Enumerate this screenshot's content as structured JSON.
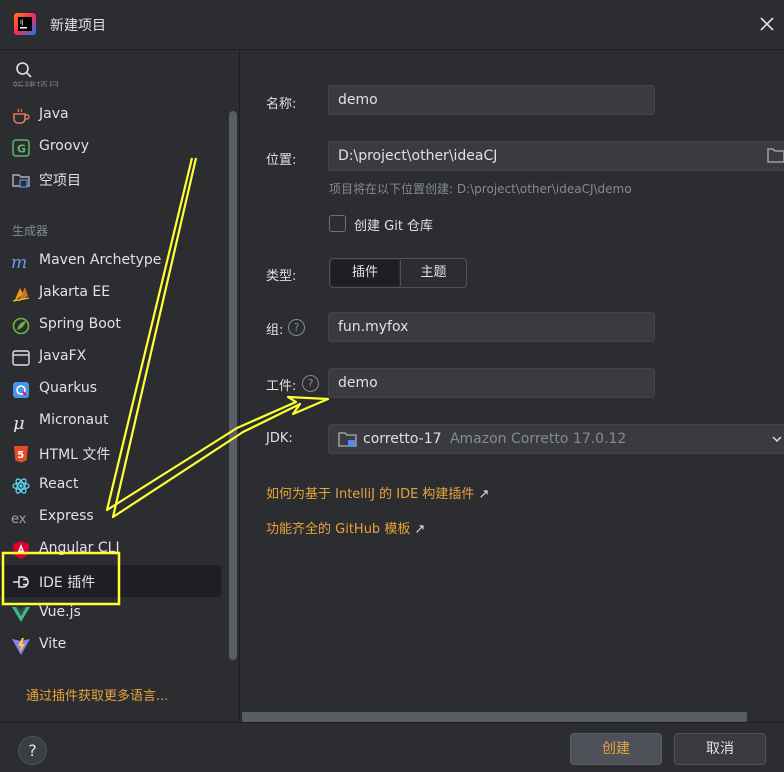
{
  "window": {
    "title": "新建项目"
  },
  "sidebar": {
    "search_icon": "search-icon",
    "cut_header": "新建项目",
    "group_generators": "生成器",
    "items_top": [
      {
        "label": "Java",
        "icon": "java-icon"
      },
      {
        "label": "Groovy",
        "icon": "groovy-icon"
      },
      {
        "label": "空项目",
        "icon": "empty-project-icon"
      }
    ],
    "items_gen": [
      {
        "label": "Maven Archetype",
        "icon": "maven-icon"
      },
      {
        "label": "Jakarta EE",
        "icon": "jakarta-icon"
      },
      {
        "label": "Spring Boot",
        "icon": "spring-icon"
      },
      {
        "label": "JavaFX",
        "icon": "javafx-icon"
      },
      {
        "label": "Quarkus",
        "icon": "quarkus-icon"
      },
      {
        "label": "Micronaut",
        "icon": "micronaut-icon"
      },
      {
        "label": "HTML 文件",
        "icon": "html5-icon"
      },
      {
        "label": "React",
        "icon": "react-icon"
      },
      {
        "label": "Express",
        "icon": "express-icon"
      },
      {
        "label": "Angular CLI",
        "icon": "angular-icon"
      },
      {
        "label": "IDE 插件",
        "icon": "plugin-icon"
      },
      {
        "label": "Vue.js",
        "icon": "vue-icon"
      },
      {
        "label": "Vite",
        "icon": "vite-icon"
      }
    ],
    "more_languages": "通过插件获取更多语言..."
  },
  "form": {
    "name_label": "名称:",
    "name_value": "demo",
    "location_label": "位置:",
    "location_value": "D:\\project\\other\\ideaCJ",
    "location_hint": "项目将在以下位置创建: D:\\project\\other\\ideaCJ\\demo",
    "git_label": "创建 Git 仓库",
    "type_label": "类型:",
    "type_options": [
      "插件",
      "主题"
    ],
    "group_label": "组:",
    "group_value": "fun.myfox",
    "artifact_label": "工件:",
    "artifact_value": "demo",
    "jdk_label": "JDK:",
    "jdk_name": "corretto-17",
    "jdk_version": "Amazon Corretto 17.0.12",
    "link1": "如何为基于 IntelliJ 的 IDE 构建插件",
    "link2": "功能齐全的 GitHub 模板",
    "help_glyph": "?",
    "arrow_glyph": "↗"
  },
  "footer": {
    "help": "?",
    "create": "创建",
    "cancel": "取消"
  },
  "colors": {
    "accent": "#e8a33d",
    "annotation": "#ffff33",
    "background": "#2b2d30"
  }
}
